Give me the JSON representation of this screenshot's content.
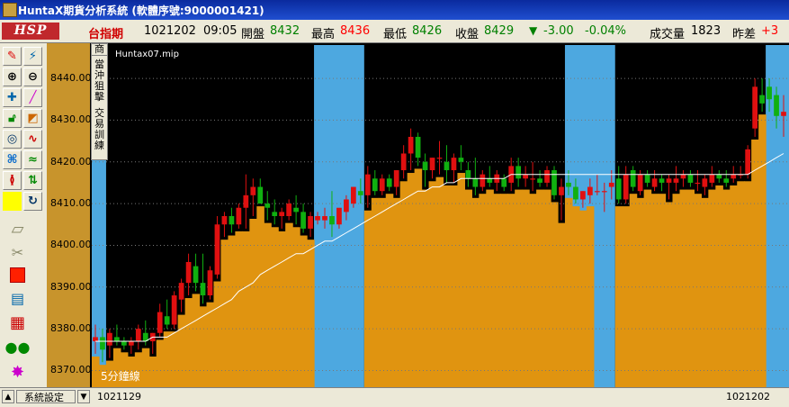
{
  "window": {
    "title": "HuntaX期貨分析系統 (軟體序號:9000001421)"
  },
  "quote": {
    "logo": "HSP",
    "symbol": "台指期",
    "date": "1021202",
    "time": "09:05",
    "open_label": "開盤",
    "open": "8432",
    "high_label": "最高",
    "high": "8436",
    "low_label": "最低",
    "low": "8426",
    "close_label": "收盤",
    "close": "8429",
    "change": "-3.00",
    "change_pct": "-0.04%",
    "volume_label": "成交量",
    "volume": "1823",
    "diff_label": "昨差",
    "diff": "+3",
    "colors": {
      "up": "#ff0000",
      "down": "#008000",
      "value": "#008000",
      "high": "#ff0000",
      "change": "#008000"
    }
  },
  "side_tab": {
    "label1": "當沖狙擊",
    "label2": "交易訓練",
    "top": "商"
  },
  "toolbar_icons": [
    "pencil-icon",
    "wand-icon",
    "zoom-in-icon",
    "zoom-out-icon",
    "crosshair-icon",
    "line-icon",
    "lock-icon",
    "ruler-icon",
    "target-icon",
    "wave-icon",
    "cycle-icon",
    "trend-icon",
    "fibonacci-icon",
    "arrows-icon",
    "yellow-square-icon",
    "refresh-icon",
    "folder-icon",
    "cut-icon",
    "stop-icon",
    "note-icon",
    "grid-icon",
    "people-icon",
    "explosion-icon"
  ],
  "chart_label": {
    "file": "Huntax07.mip",
    "interval": "5分鐘線"
  },
  "status": {
    "settings": "系統設定",
    "start_date": "1021129",
    "end_date": "1021202"
  },
  "chart_data": {
    "type": "candlestick",
    "ylim": [
      8366,
      8448
    ],
    "yticks": [
      8370,
      8380,
      8390,
      8400,
      8410,
      8420,
      8430,
      8440
    ],
    "ytick_labels": [
      "8370.00",
      "8380.00",
      "8390.00",
      "8400.00",
      "8410.00",
      "8420.00",
      "8430.00",
      "8440.00"
    ],
    "colors": {
      "up": "#e01010",
      "down": "#10b010",
      "area": "#e09410",
      "band": "#4da8e0",
      "ma": "#ffffff"
    },
    "candles": [
      [
        8377,
        8381,
        8374,
        8378
      ],
      [
        8378,
        8380,
        8372,
        8375
      ],
      [
        8376,
        8380,
        8373,
        8379
      ],
      [
        8378,
        8381,
        8376,
        8377
      ],
      [
        8377,
        8378,
        8375,
        8376
      ],
      [
        8376,
        8378,
        8374,
        8377
      ],
      [
        8377,
        8381,
        8375,
        8380
      ],
      [
        8379,
        8382,
        8376,
        8377
      ],
      [
        8377,
        8379,
        8374,
        8379
      ],
      [
        8379,
        8386,
        8378,
        8384
      ],
      [
        8383,
        8387,
        8380,
        8381
      ],
      [
        8381,
        8389,
        8380,
        8388
      ],
      [
        8387,
        8392,
        8384,
        8391
      ],
      [
        8391,
        8398,
        8388,
        8396
      ],
      [
        8395,
        8398,
        8389,
        8391
      ],
      [
        8391,
        8398,
        8386,
        8388
      ],
      [
        8388,
        8395,
        8387,
        8394
      ],
      [
        8393,
        8407,
        8392,
        8405
      ],
      [
        8405,
        8408,
        8402,
        8407
      ],
      [
        8407,
        8409,
        8403,
        8405
      ],
      [
        8405,
        8410,
        8404,
        8409
      ],
      [
        8409,
        8417,
        8404,
        8412
      ],
      [
        8412,
        8416,
        8407,
        8414
      ],
      [
        8414,
        8416,
        8410,
        8410
      ],
      [
        8410,
        8413,
        8406,
        8409
      ],
      [
        8408,
        8411,
        8405,
        8407
      ],
      [
        8407,
        8409,
        8404,
        8408
      ],
      [
        8407,
        8411,
        8406,
        8410
      ],
      [
        8409,
        8412,
        8405,
        8408
      ],
      [
        8408,
        8410,
        8403,
        8404
      ],
      [
        8404,
        8408,
        8402,
        8407
      ],
      [
        8406,
        8408,
        8405,
        8407
      ],
      [
        8406,
        8409,
        8404,
        8407
      ],
      [
        8407,
        8413,
        8402,
        8405
      ],
      [
        8405,
        8408,
        8404,
        8409
      ],
      [
        8408,
        8412,
        8406,
        8411
      ],
      [
        8410,
        8414,
        8409,
        8414
      ],
      [
        8413,
        8416,
        8410,
        8412
      ],
      [
        8412,
        8419,
        8409,
        8417
      ],
      [
        8416,
        8418,
        8412,
        8413
      ],
      [
        8413,
        8417,
        8412,
        8416
      ],
      [
        8416,
        8417,
        8413,
        8414
      ],
      [
        8414,
        8418,
        8412,
        8418
      ],
      [
        8418,
        8424,
        8416,
        8422
      ],
      [
        8422,
        8428,
        8418,
        8426
      ],
      [
        8426,
        8427,
        8419,
        8421
      ],
      [
        8420,
        8422,
        8414,
        8418
      ],
      [
        8418,
        8421,
        8416,
        8421
      ],
      [
        8421,
        8425,
        8417,
        8421
      ],
      [
        8420,
        8424,
        8415,
        8418
      ],
      [
        8418,
        8422,
        8415,
        8421
      ],
      [
        8421,
        8424,
        8418,
        8420
      ],
      [
        8418,
        8420,
        8414,
        8416
      ],
      [
        8416,
        8421,
        8412,
        8414
      ],
      [
        8414,
        8418,
        8413,
        8417
      ],
      [
        8416,
        8419,
        8414,
        8415
      ],
      [
        8415,
        8418,
        8413,
        8417
      ],
      [
        8416,
        8417,
        8413,
        8414
      ],
      [
        8415,
        8421,
        8413,
        8419
      ],
      [
        8419,
        8421,
        8414,
        8416
      ],
      [
        8416,
        8419,
        8414,
        8417
      ],
      [
        8416,
        8420,
        8413,
        8416
      ],
      [
        8416,
        8418,
        8414,
        8415
      ],
      [
        8415,
        8419,
        8414,
        8418
      ],
      [
        8418,
        8419,
        8411,
        8412
      ],
      [
        8412,
        8416,
        8406,
        8414
      ],
      [
        8415,
        8418,
        8412,
        8414
      ],
      [
        8414,
        8416,
        8410,
        8411
      ],
      [
        8411,
        8413,
        8409,
        8413
      ],
      [
        8412,
        8416,
        8410,
        8414
      ],
      [
        8413,
        8417,
        8412,
        8413
      ],
      [
        8413,
        8415,
        8408,
        8413
      ],
      [
        8414,
        8418,
        8411,
        8415
      ],
      [
        8416,
        8419,
        8410,
        8411
      ],
      [
        8411,
        8419,
        8410,
        8417
      ],
      [
        8418,
        8419,
        8413,
        8414
      ],
      [
        8413,
        8418,
        8412,
        8417
      ],
      [
        8417,
        8418,
        8414,
        8415
      ],
      [
        8414,
        8418,
        8413,
        8416
      ],
      [
        8416,
        8417,
        8413,
        8415
      ],
      [
        8415,
        8417,
        8411,
        8416
      ],
      [
        8415,
        8419,
        8413,
        8416
      ],
      [
        8416,
        8418,
        8414,
        8417
      ],
      [
        8417,
        8418,
        8414,
        8415
      ],
      [
        8415,
        8418,
        8413,
        8415
      ],
      [
        8414,
        8417,
        8412,
        8416
      ],
      [
        8415,
        8419,
        8414,
        8417
      ],
      [
        8417,
        8418,
        8415,
        8416
      ],
      [
        8416,
        8418,
        8414,
        8415
      ],
      [
        8416,
        8419,
        8415,
        8417
      ],
      [
        8417,
        8419,
        8416,
        8417
      ],
      [
        8417,
        8424,
        8416,
        8423
      ],
      [
        8428,
        8440,
        8426,
        8438
      ],
      [
        8436,
        8440,
        8432,
        8434
      ],
      [
        8438,
        8440,
        8432,
        8435
      ],
      [
        8436,
        8438,
        8428,
        8431
      ],
      [
        8431,
        8436,
        8426,
        8432
      ]
    ],
    "ma": [
      8377,
      8377,
      8377,
      8377,
      8377,
      8377,
      8377,
      8377,
      8378,
      8378,
      8378,
      8379,
      8380,
      8381,
      8382,
      8383,
      8384,
      8385,
      8386,
      8387,
      8389,
      8390,
      8391,
      8393,
      8394,
      8395,
      8396,
      8397,
      8398,
      8398,
      8399,
      8400,
      8401,
      8401,
      8402,
      8403,
      8404,
      8405,
      8406,
      8407,
      8408,
      8409,
      8410,
      8411,
      8412,
      8413,
      8413,
      8414,
      8414,
      8415,
      8415,
      8416,
      8416,
      8416,
      8416,
      8416,
      8416,
      8416,
      8417,
      8417,
      8417,
      8417,
      8417,
      8417,
      8417,
      8417,
      8417,
      8417,
      8417,
      8417,
      8417,
      8417,
      8417,
      8417,
      8417,
      8417,
      8417,
      8417,
      8417,
      8417,
      8417,
      8417,
      8417,
      8417,
      8417,
      8417,
      8417,
      8417,
      8417,
      8417,
      8417,
      8417,
      8418,
      8419,
      8420,
      8421,
      8422
    ],
    "bands": [
      [
        0,
        1
      ],
      [
        31,
        37
      ],
      [
        66,
        72
      ],
      [
        94,
        97
      ]
    ],
    "area_gaps": [
      [
        31,
        37
      ],
      [
        70,
        72
      ],
      [
        94,
        97
      ]
    ]
  }
}
